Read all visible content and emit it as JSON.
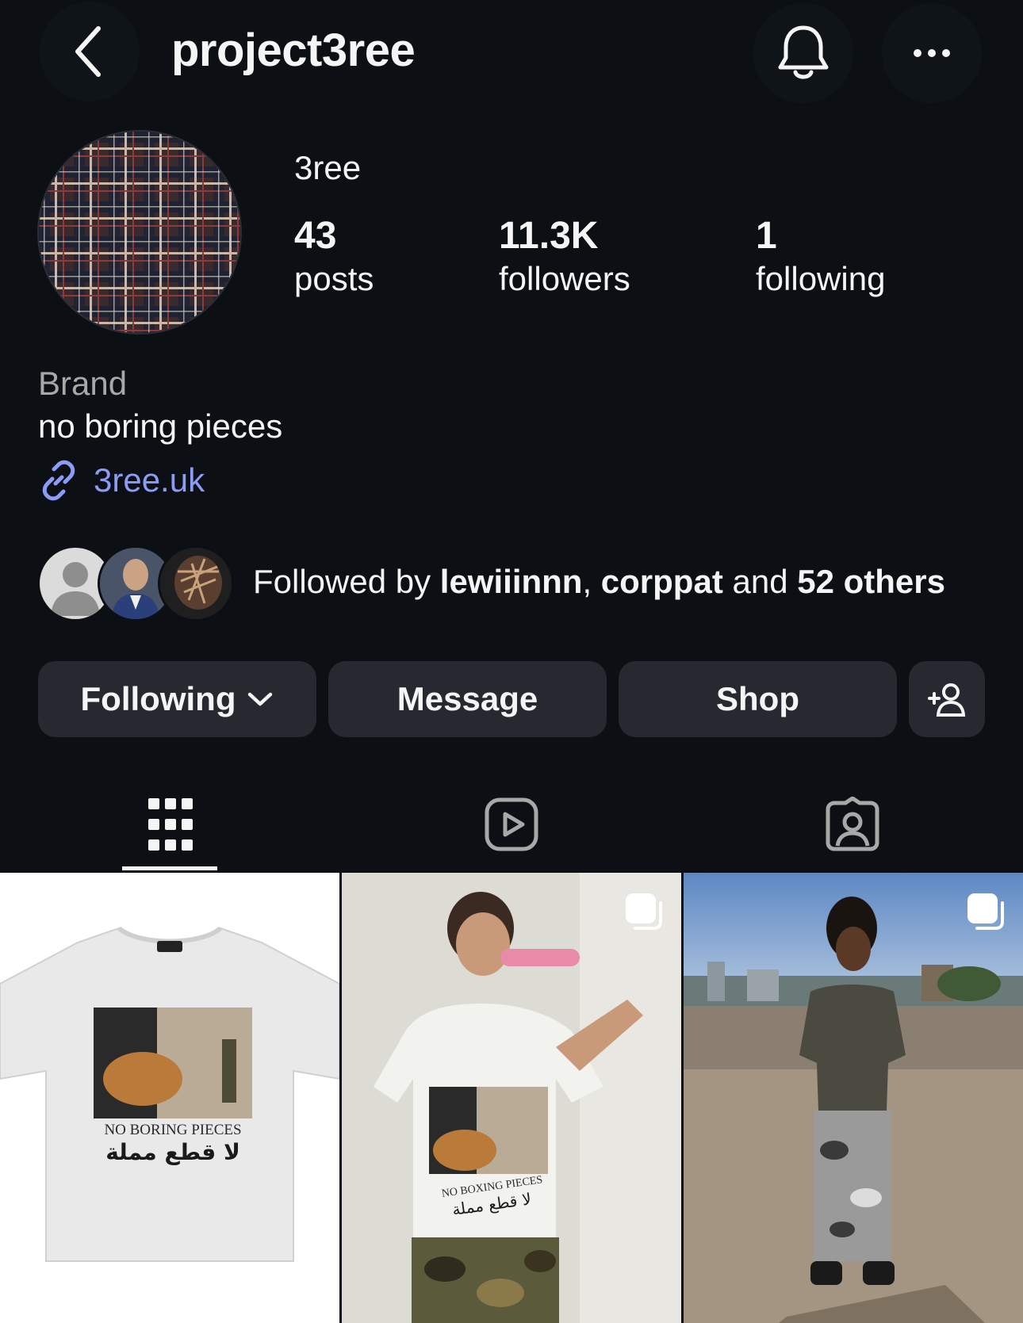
{
  "header": {
    "username": "project3ree",
    "icons": [
      "chevron-left-icon",
      "bell-icon",
      "more-horizontal-icon"
    ]
  },
  "profile": {
    "display_name": "3ree",
    "stats": {
      "posts": {
        "value": "43",
        "label": "posts"
      },
      "followers": {
        "value": "11.3K",
        "label": "followers"
      },
      "following": {
        "value": "1",
        "label": "following"
      }
    },
    "category": "Brand",
    "bio": "no boring pieces",
    "link": "3ree.uk"
  },
  "followed_by": {
    "prefix": "Followed by ",
    "user1": "lewiiinnn",
    "separator": ", ",
    "user2": "corppat",
    "connector": " and ",
    "others": "52 others"
  },
  "actions": {
    "following": "Following",
    "message": "Message",
    "shop": "Shop"
  },
  "tabs": {
    "active": "grid",
    "items": [
      "grid-icon",
      "reels-icon",
      "tagged-icon"
    ]
  },
  "posts": [
    {
      "print_line1": "NO BORING PIECES",
      "print_line2": "لا قطع مملة",
      "carousel": false
    },
    {
      "print_line1": "NO BOXING PIECES",
      "print_line2": "لا قطع مملة",
      "carousel": true
    },
    {
      "carousel": true
    }
  ],
  "colors": {
    "background": "#0c1014",
    "button": "#262a30",
    "link": "#8c9cf5",
    "secondary_text": "#a8a8a8"
  }
}
